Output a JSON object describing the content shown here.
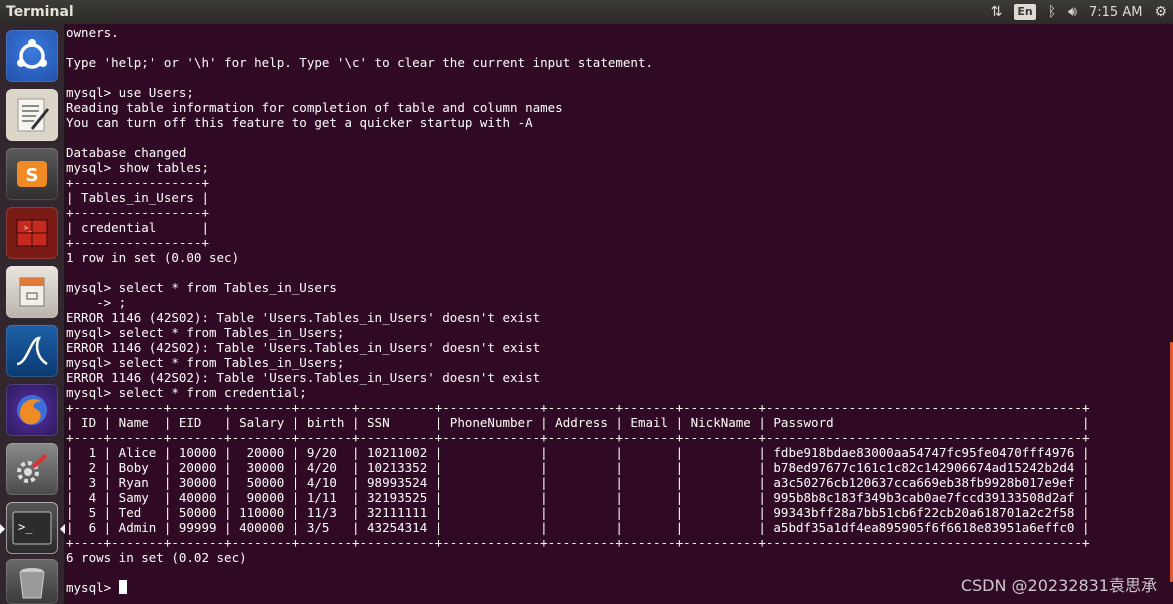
{
  "topbar": {
    "app_title": "Terminal",
    "lang": "En",
    "clock": "7:15 AM"
  },
  "launcher": [
    {
      "name": "ubuntu-dash-icon"
    },
    {
      "name": "text-editor-icon"
    },
    {
      "name": "sublime-text-icon"
    },
    {
      "name": "system-monitor-icon"
    },
    {
      "name": "file-manager-icon"
    },
    {
      "name": "wireshark-icon"
    },
    {
      "name": "firefox-icon"
    },
    {
      "name": "system-settings-icon"
    },
    {
      "name": "terminal-icon"
    },
    {
      "name": "trash-icon"
    }
  ],
  "terminal": {
    "lines": [
      "owners.",
      "",
      "Type 'help;' or '\\h' for help. Type '\\c' to clear the current input statement.",
      "",
      "mysql> use Users;",
      "Reading table information for completion of table and column names",
      "You can turn off this feature to get a quicker startup with -A",
      "",
      "Database changed",
      "mysql> show tables;",
      "+-----------------+",
      "| Tables_in_Users |",
      "+-----------------+",
      "| credential      |",
      "+-----------------+",
      "1 row in set (0.00 sec)",
      "",
      "mysql> select * from Tables_in_Users",
      "    -> ;",
      "ERROR 1146 (42S02): Table 'Users.Tables_in_Users' doesn't exist",
      "mysql> select * from Tables_in_Users;",
      "ERROR 1146 (42S02): Table 'Users.Tables_in_Users' doesn't exist",
      "mysql> select * from Tables_in_Users;",
      "ERROR 1146 (42S02): Table 'Users.Tables_in_Users' doesn't exist",
      "mysql> select * from credential;",
      "+----+-------+-------+--------+-------+----------+-------------+---------+-------+----------+------------------------------------------+",
      "| ID | Name  | EID   | Salary | birth | SSN      | PhoneNumber | Address | Email | NickName | Password                                 |",
      "+----+-------+-------+--------+-------+----------+-------------+---------+-------+----------+------------------------------------------+",
      "|  1 | Alice | 10000 |  20000 | 9/20  | 10211002 |             |         |       |          | fdbe918bdae83000aa54747fc95fe0470fff4976 |",
      "|  2 | Boby  | 20000 |  30000 | 4/20  | 10213352 |             |         |       |          | b78ed97677c161c1c82c142906674ad15242b2d4 |",
      "|  3 | Ryan  | 30000 |  50000 | 4/10  | 98993524 |             |         |       |          | a3c50276cb120637cca669eb38fb9928b017e9ef |",
      "|  4 | Samy  | 40000 |  90000 | 1/11  | 32193525 |             |         |       |          | 995b8b8c183f349b3cab0ae7fccd39133508d2af |",
      "|  5 | Ted   | 50000 | 110000 | 11/3  | 32111111 |             |         |       |          | 99343bff28a7bb51cb6f22cb20a618701a2c2f58 |",
      "|  6 | Admin | 99999 | 400000 | 3/5   | 43254314 |             |         |       |          | a5bdf35a1df4ea895905f6f6618e83951a6effc0 |",
      "+----+-------+-------+--------+-------+----------+-------------+---------+-------+----------+------------------------------------------+",
      "6 rows in set (0.02 sec)",
      "",
      "mysql> "
    ]
  },
  "watermark": "CSDN @20232831袁思承"
}
